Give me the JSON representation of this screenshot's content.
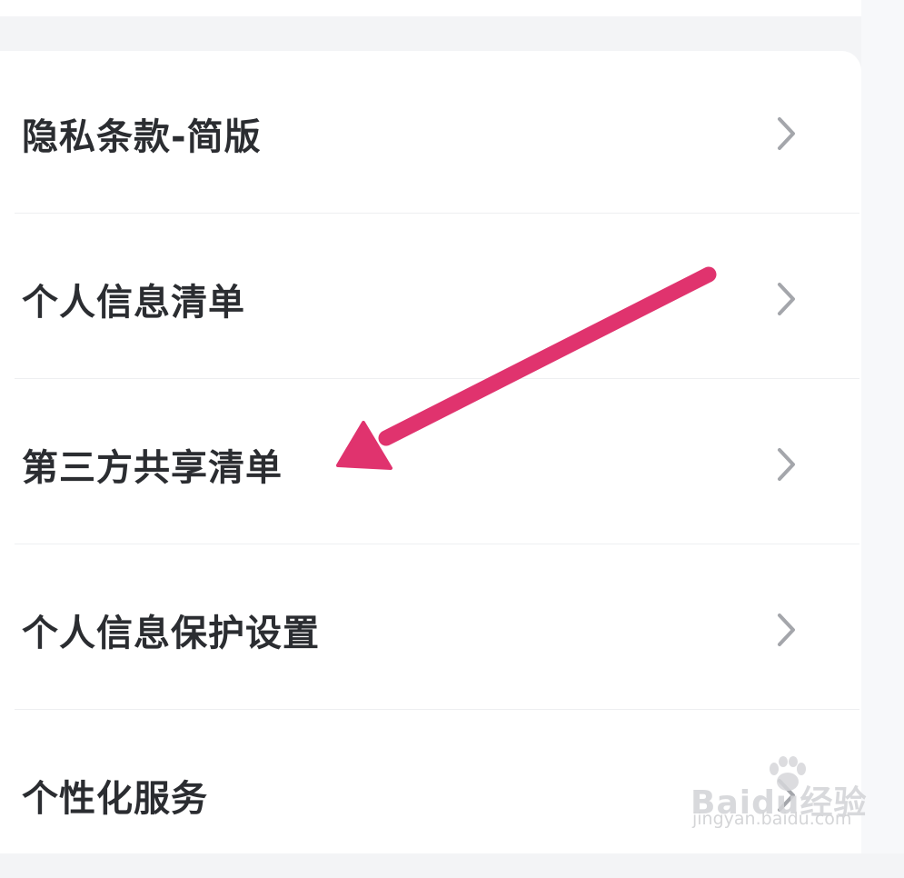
{
  "menu": {
    "items": [
      {
        "label": "隐私条款-简版",
        "icon": "chevron-right-icon"
      },
      {
        "label": "个人信息清单",
        "icon": "chevron-right-icon"
      },
      {
        "label": "第三方共享清单",
        "icon": "chevron-right-icon"
      },
      {
        "label": "个人信息保护设置",
        "icon": "chevron-right-icon"
      },
      {
        "label": "个性化服务",
        "icon": "chevron-right-icon"
      }
    ]
  },
  "annotation": {
    "arrow_color": "#e0336e",
    "points_to": "第三方共享清单"
  },
  "watermark": {
    "brand": "Baidu经验",
    "url": "jingyan.baidu.com"
  },
  "colors": {
    "background": "#f3f4f6",
    "card": "#ffffff",
    "text": "#2b2d31",
    "chevron": "#a4a6ab",
    "divider": "#eeeff1"
  }
}
